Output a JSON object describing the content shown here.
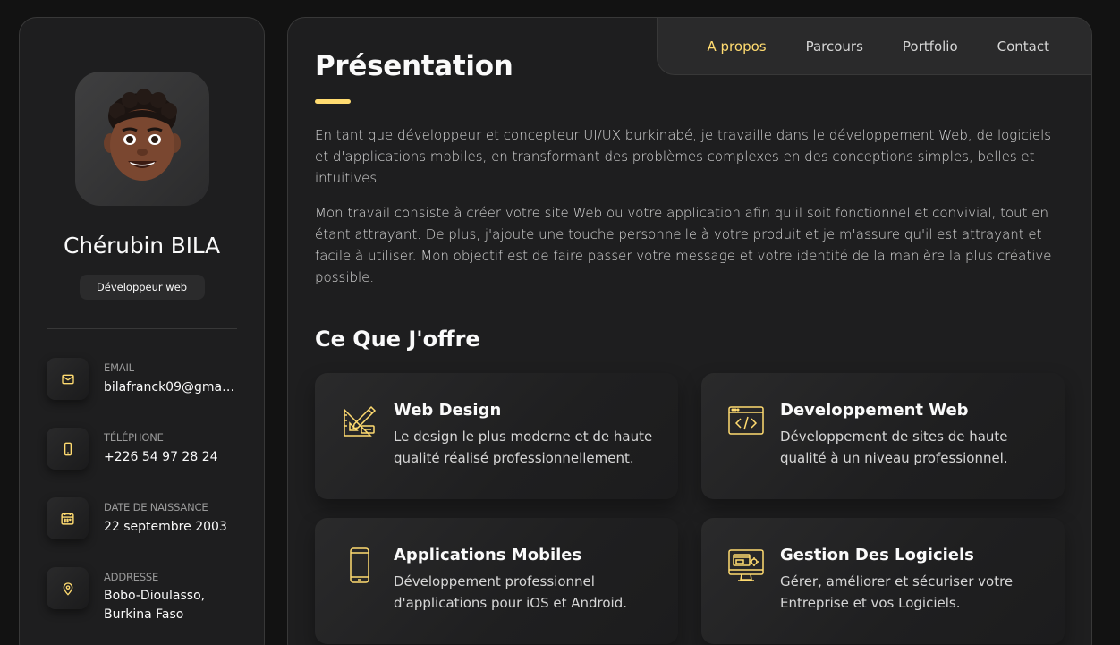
{
  "profile": {
    "name": "Chérubin BILA",
    "role": "Développeur web",
    "contacts": [
      {
        "label": "EMAIL",
        "value": "bilafranck09@gmail...",
        "icon": "mail-icon"
      },
      {
        "label": "TÉLÉPHONE",
        "value": "+226 54 97 28 24",
        "icon": "phone-icon"
      },
      {
        "label": "DATE DE NAISSANCE",
        "value": "22 septembre 2003",
        "icon": "calendar-icon"
      },
      {
        "label": "ADDRESSE",
        "value": "Bobo-Dioulasso, Burkina Faso",
        "icon": "location-pin-icon"
      }
    ]
  },
  "nav": {
    "items": [
      "A propos",
      "Parcours",
      "Portfolio",
      "Contact"
    ],
    "active": "A propos"
  },
  "about": {
    "title": "Présentation",
    "paragraphs": [
      "En tant que développeur et concepteur UI/UX burkinabé, je travaille dans le développement Web, de logiciels et d'applications mobiles, en transformant des problèmes complexes en des conceptions simples, belles et intuitives.",
      "Mon travail consiste à créer votre site Web ou votre application afin qu'il soit fonctionnel et convivial, tout en étant attrayant. De plus, j'ajoute une touche personnelle à votre produit et je m'assure qu'il est attrayant et facile à utiliser. Mon objectif est de faire passer votre message et votre identité de la manière la plus créative possible."
    ]
  },
  "offer": {
    "title": "Ce Que J'offre",
    "services": [
      {
        "title": "Web Design",
        "desc": "Le design le plus moderne et de haute qualité réalisé professionnellement.",
        "icon": "design-tools-icon"
      },
      {
        "title": "Developpement Web",
        "desc": "Développement de sites de haute qualité à un niveau professionnel.",
        "icon": "code-window-icon"
      },
      {
        "title": "Applications Mobiles",
        "desc": "Développement professionnel d'applications pour iOS et Android.",
        "icon": "smartphone-icon"
      },
      {
        "title": "Gestion Des Logiciels",
        "desc": "Gérer, améliorer et sécuriser votre Entreprise et vos Logiciels.",
        "icon": "monitor-settings-icon"
      }
    ]
  },
  "colors": {
    "accent": "#ffdb70",
    "background": "#121212",
    "card": "#1e1e1f"
  }
}
